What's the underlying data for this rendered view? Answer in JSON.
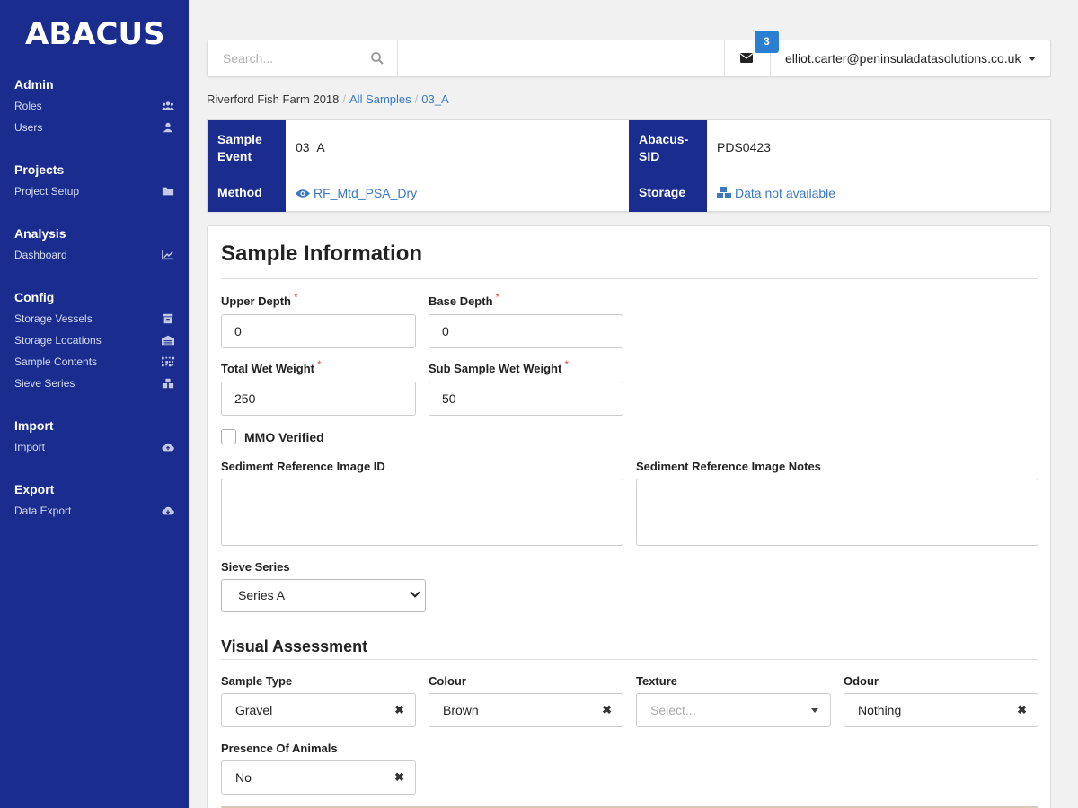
{
  "sidebar": {
    "logo": "ABACUS",
    "sections": [
      {
        "heading": "Admin",
        "items": [
          {
            "label": "Roles",
            "icon": "users-group-icon"
          },
          {
            "label": "Users",
            "icon": "user-icon"
          }
        ]
      },
      {
        "heading": "Projects",
        "items": [
          {
            "label": "Project Setup",
            "icon": "folder-icon"
          }
        ]
      },
      {
        "heading": "Analysis",
        "items": [
          {
            "label": "Dashboard",
            "icon": "line-chart-icon"
          }
        ]
      },
      {
        "heading": "Config",
        "items": [
          {
            "label": "Storage Vessels",
            "icon": "archive-icon"
          },
          {
            "label": "Storage Locations",
            "icon": "warehouse-icon"
          },
          {
            "label": "Sample Contents",
            "icon": "grid-dots-icon"
          },
          {
            "label": "Sieve Series",
            "icon": "boxes-icon"
          }
        ]
      },
      {
        "heading": "Import",
        "items": [
          {
            "label": "Import",
            "icon": "cloud-upload-icon"
          }
        ]
      },
      {
        "heading": "Export",
        "items": [
          {
            "label": "Data Export",
            "icon": "cloud-download-icon"
          }
        ]
      }
    ]
  },
  "topbar": {
    "search_placeholder": "Search...",
    "mail_count": "3",
    "user_email": "elliot.carter@peninsuladatasolutions.co.uk"
  },
  "breadcrumb": {
    "project": "Riverford Fish Farm 2018",
    "all_samples": "All Samples",
    "current": "03_A"
  },
  "info": {
    "sample_event_label": "Sample Event",
    "sample_event_value": "03_A",
    "abacus_sid_label": "Abacus-SID",
    "abacus_sid_value": "PDS0423",
    "method_label": "Method",
    "method_value": "RF_Mtd_PSA_Dry",
    "storage_label": "Storage",
    "storage_value": "Data not available"
  },
  "sample_info": {
    "title": "Sample Information",
    "upper_depth_label": "Upper Depth",
    "upper_depth_value": "0",
    "base_depth_label": "Base Depth",
    "base_depth_value": "0",
    "total_wet_weight_label": "Total Wet Weight",
    "total_wet_weight_value": "250",
    "sub_sample_wet_weight_label": "Sub Sample Wet Weight",
    "sub_sample_wet_weight_value": "50",
    "required_mark": "*",
    "mmo_verified_label": "MMO Verified",
    "mmo_verified_checked": false,
    "sed_ref_image_id_label": "Sediment Reference Image ID",
    "sed_ref_image_notes_label": "Sediment Reference Image Notes",
    "sieve_series_label": "Sieve Series",
    "sieve_series_value": "Series A"
  },
  "visual_assessment": {
    "title": "Visual Assessment",
    "sample_type_label": "Sample Type",
    "sample_type_value": "Gravel",
    "colour_label": "Colour",
    "colour_value": "Brown",
    "texture_label": "Texture",
    "texture_placeholder": "Select...",
    "odour_label": "Odour",
    "odour_value": "Nothing",
    "presence_label": "Presence Of Animals",
    "presence_value": "No",
    "clear_glyph": "✖"
  },
  "colors": {
    "sidebar_bg": "#1a2d8f",
    "link": "#3a78c3",
    "badge": "#2b7fd0",
    "required": "#d9534f"
  }
}
